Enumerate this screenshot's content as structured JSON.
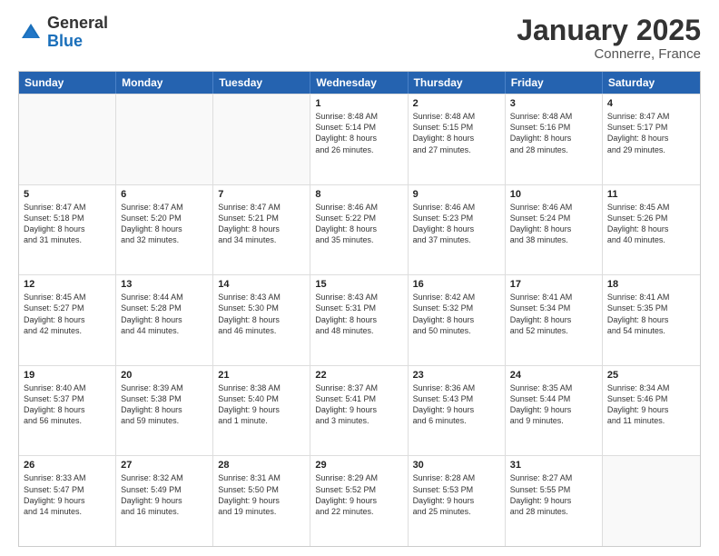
{
  "logo": {
    "general": "General",
    "blue": "Blue"
  },
  "header": {
    "month": "January 2025",
    "location": "Connerre, France"
  },
  "days": [
    "Sunday",
    "Monday",
    "Tuesday",
    "Wednesday",
    "Thursday",
    "Friday",
    "Saturday"
  ],
  "weeks": [
    [
      {
        "day": "",
        "content": ""
      },
      {
        "day": "",
        "content": ""
      },
      {
        "day": "",
        "content": ""
      },
      {
        "day": "1",
        "content": "Sunrise: 8:48 AM\nSunset: 5:14 PM\nDaylight: 8 hours\nand 26 minutes."
      },
      {
        "day": "2",
        "content": "Sunrise: 8:48 AM\nSunset: 5:15 PM\nDaylight: 8 hours\nand 27 minutes."
      },
      {
        "day": "3",
        "content": "Sunrise: 8:48 AM\nSunset: 5:16 PM\nDaylight: 8 hours\nand 28 minutes."
      },
      {
        "day": "4",
        "content": "Sunrise: 8:47 AM\nSunset: 5:17 PM\nDaylight: 8 hours\nand 29 minutes."
      }
    ],
    [
      {
        "day": "5",
        "content": "Sunrise: 8:47 AM\nSunset: 5:18 PM\nDaylight: 8 hours\nand 31 minutes."
      },
      {
        "day": "6",
        "content": "Sunrise: 8:47 AM\nSunset: 5:20 PM\nDaylight: 8 hours\nand 32 minutes."
      },
      {
        "day": "7",
        "content": "Sunrise: 8:47 AM\nSunset: 5:21 PM\nDaylight: 8 hours\nand 34 minutes."
      },
      {
        "day": "8",
        "content": "Sunrise: 8:46 AM\nSunset: 5:22 PM\nDaylight: 8 hours\nand 35 minutes."
      },
      {
        "day": "9",
        "content": "Sunrise: 8:46 AM\nSunset: 5:23 PM\nDaylight: 8 hours\nand 37 minutes."
      },
      {
        "day": "10",
        "content": "Sunrise: 8:46 AM\nSunset: 5:24 PM\nDaylight: 8 hours\nand 38 minutes."
      },
      {
        "day": "11",
        "content": "Sunrise: 8:45 AM\nSunset: 5:26 PM\nDaylight: 8 hours\nand 40 minutes."
      }
    ],
    [
      {
        "day": "12",
        "content": "Sunrise: 8:45 AM\nSunset: 5:27 PM\nDaylight: 8 hours\nand 42 minutes."
      },
      {
        "day": "13",
        "content": "Sunrise: 8:44 AM\nSunset: 5:28 PM\nDaylight: 8 hours\nand 44 minutes."
      },
      {
        "day": "14",
        "content": "Sunrise: 8:43 AM\nSunset: 5:30 PM\nDaylight: 8 hours\nand 46 minutes."
      },
      {
        "day": "15",
        "content": "Sunrise: 8:43 AM\nSunset: 5:31 PM\nDaylight: 8 hours\nand 48 minutes."
      },
      {
        "day": "16",
        "content": "Sunrise: 8:42 AM\nSunset: 5:32 PM\nDaylight: 8 hours\nand 50 minutes."
      },
      {
        "day": "17",
        "content": "Sunrise: 8:41 AM\nSunset: 5:34 PM\nDaylight: 8 hours\nand 52 minutes."
      },
      {
        "day": "18",
        "content": "Sunrise: 8:41 AM\nSunset: 5:35 PM\nDaylight: 8 hours\nand 54 minutes."
      }
    ],
    [
      {
        "day": "19",
        "content": "Sunrise: 8:40 AM\nSunset: 5:37 PM\nDaylight: 8 hours\nand 56 minutes."
      },
      {
        "day": "20",
        "content": "Sunrise: 8:39 AM\nSunset: 5:38 PM\nDaylight: 8 hours\nand 59 minutes."
      },
      {
        "day": "21",
        "content": "Sunrise: 8:38 AM\nSunset: 5:40 PM\nDaylight: 9 hours\nand 1 minute."
      },
      {
        "day": "22",
        "content": "Sunrise: 8:37 AM\nSunset: 5:41 PM\nDaylight: 9 hours\nand 3 minutes."
      },
      {
        "day": "23",
        "content": "Sunrise: 8:36 AM\nSunset: 5:43 PM\nDaylight: 9 hours\nand 6 minutes."
      },
      {
        "day": "24",
        "content": "Sunrise: 8:35 AM\nSunset: 5:44 PM\nDaylight: 9 hours\nand 9 minutes."
      },
      {
        "day": "25",
        "content": "Sunrise: 8:34 AM\nSunset: 5:46 PM\nDaylight: 9 hours\nand 11 minutes."
      }
    ],
    [
      {
        "day": "26",
        "content": "Sunrise: 8:33 AM\nSunset: 5:47 PM\nDaylight: 9 hours\nand 14 minutes."
      },
      {
        "day": "27",
        "content": "Sunrise: 8:32 AM\nSunset: 5:49 PM\nDaylight: 9 hours\nand 16 minutes."
      },
      {
        "day": "28",
        "content": "Sunrise: 8:31 AM\nSunset: 5:50 PM\nDaylight: 9 hours\nand 19 minutes."
      },
      {
        "day": "29",
        "content": "Sunrise: 8:29 AM\nSunset: 5:52 PM\nDaylight: 9 hours\nand 22 minutes."
      },
      {
        "day": "30",
        "content": "Sunrise: 8:28 AM\nSunset: 5:53 PM\nDaylight: 9 hours\nand 25 minutes."
      },
      {
        "day": "31",
        "content": "Sunrise: 8:27 AM\nSunset: 5:55 PM\nDaylight: 9 hours\nand 28 minutes."
      },
      {
        "day": "",
        "content": ""
      }
    ]
  ]
}
